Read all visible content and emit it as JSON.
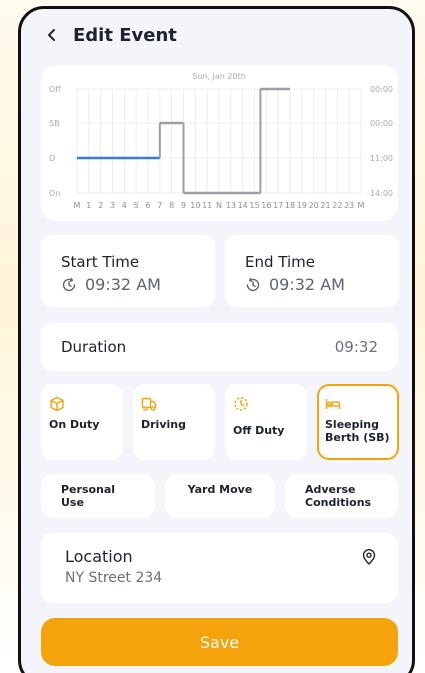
{
  "header": {
    "title": "Edit Event"
  },
  "chart": {
    "date_label": "Sun, Jan 20th",
    "y_labels": [
      "Off",
      "SB",
      "D",
      "On"
    ],
    "right_labels": [
      "00:00",
      "00:00",
      "11:00",
      "14:00"
    ],
    "x_ticks": [
      "M",
      "1",
      "2",
      "3",
      "4",
      "5",
      "6",
      "7",
      "8",
      "9",
      "10",
      "11",
      "N",
      "13",
      "14",
      "15",
      "16",
      "17",
      "18",
      "19",
      "20",
      "21",
      "22",
      "23",
      "M"
    ],
    "series": [
      {
        "status": "D",
        "start_hour": 0,
        "end_hour": 7,
        "color": "#3A7BD5"
      },
      {
        "status": "SB",
        "start_hour": 7,
        "end_hour": 9,
        "color": "#9AA0A6"
      },
      {
        "status": "On",
        "start_hour": 9,
        "end_hour": 15.5,
        "color": "#9AA0A6"
      },
      {
        "status": "Off",
        "start_hour": 15.5,
        "end_hour": 18,
        "color": "#9AA0A6"
      }
    ]
  },
  "times": {
    "start_label": "Start Time",
    "start_value": "09:32 AM",
    "end_label": "End Time",
    "end_value": "09:32 AM"
  },
  "duration": {
    "label": "Duration",
    "value": "09:32"
  },
  "statuses": [
    {
      "label": "On Duty",
      "icon": "cube-icon",
      "selected": false
    },
    {
      "label": "Driving",
      "icon": "truck-icon",
      "selected": false
    },
    {
      "label": "Off Duty",
      "icon": "clock-off-icon",
      "selected": false
    },
    {
      "label": "Sleeping Berth (SB)",
      "icon": "bed-icon",
      "selected": true
    }
  ],
  "options": [
    {
      "label": "Personal Use"
    },
    {
      "label": "Yard Move"
    },
    {
      "label": "Adverse Conditions"
    }
  ],
  "location": {
    "label": "Location",
    "value": "NY Street 234"
  },
  "save_label": "Save",
  "colors": {
    "accent": "#F5A30B",
    "driving_line": "#3A7BD5"
  }
}
